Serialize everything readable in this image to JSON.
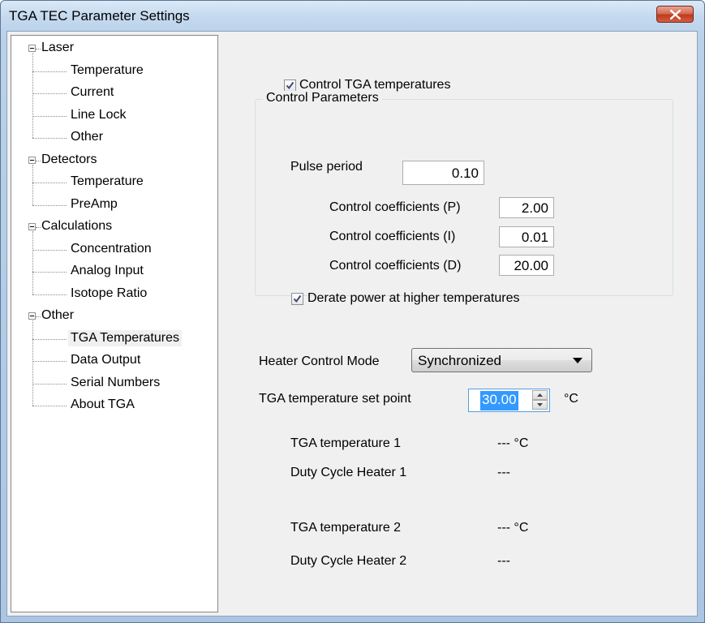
{
  "window": {
    "title": "TGA TEC Parameter Settings",
    "close_icon": "close-icon"
  },
  "tree": [
    {
      "label": "Laser",
      "children": [
        "Temperature",
        "Current",
        "Line Lock",
        "Other"
      ]
    },
    {
      "label": "Detectors",
      "children": [
        "Temperature",
        "PreAmp"
      ]
    },
    {
      "label": "Calculations",
      "children": [
        "Concentration",
        "Analog Input",
        "Isotope Ratio"
      ]
    },
    {
      "label": "Other",
      "children": [
        "TGA Temperatures",
        "Data Output",
        "Serial Numbers",
        "About TGA"
      ]
    }
  ],
  "tree_selected": "TGA Temperatures",
  "control_tga": {
    "label": "Control TGA temperatures",
    "checked": true
  },
  "control_params": {
    "title": "Control Parameters",
    "pulse_period": {
      "label": "Pulse period",
      "value": "0.10"
    },
    "coef_p": {
      "label": "Control coefficients (P)",
      "value": "2.00"
    },
    "coef_i": {
      "label": "Control coefficients  (I)",
      "value": "0.01"
    },
    "coef_d": {
      "label": "Control coefficients (D)",
      "value": "20.00"
    },
    "derate": {
      "label": "Derate power at higher temperatures",
      "checked": true
    }
  },
  "heater": {
    "label": "Heater Control Mode",
    "value": "Synchronized"
  },
  "setpoint": {
    "label": "TGA temperature set point",
    "value": "30.00",
    "unit": "°C"
  },
  "readouts": {
    "t1": {
      "label": "TGA temperature 1",
      "value": "--- °C"
    },
    "d1": {
      "label": "Duty Cycle Heater 1",
      "value": "---"
    },
    "t2": {
      "label": "TGA temperature 2",
      "value": "--- °C"
    },
    "d2": {
      "label": "Duty Cycle Heater 2",
      "value": "---"
    }
  }
}
